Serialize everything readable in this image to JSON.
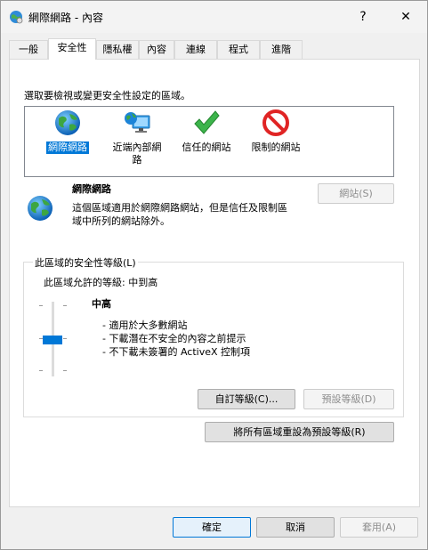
{
  "window": {
    "title": "網際網路 - 內容",
    "help_label": "?",
    "close_label": "✕"
  },
  "tabs": [
    "一般",
    "安全性",
    "隱私權",
    "內容",
    "連線",
    "程式",
    "進階"
  ],
  "security": {
    "zone_prompt": "選取要檢視或變更安全性設定的區域。",
    "zones": [
      {
        "label": "網際網路",
        "icon": "globe-icon"
      },
      {
        "label": "近端內部網\n路",
        "icon": "intranet-icon"
      },
      {
        "label": "信任的網站",
        "icon": "checkmark-icon"
      },
      {
        "label": "限制的網站",
        "icon": "restricted-icon"
      }
    ],
    "selected_zone": "網際網路",
    "zone_title": "網際網路",
    "zone_desc_line1": "這個區域適用於網際網路網站，但是信任及限制區",
    "zone_desc_line2": "域中所列的網站除外。",
    "sites_button": "網站(S)",
    "group_title": "此區域的安全性等級(L)",
    "allowed_levels": "此區域允許的等級: 中到高",
    "level_name": "中高",
    "level_bullets": [
      "- 適用於大多數網站",
      "- 下載潛在不安全的內容之前提示",
      "- 不下載未簽署的 ActiveX 控制項"
    ],
    "custom_level_button": "自訂等級(C)...",
    "default_level_button": "預設等級(D)",
    "reset_all_button": "將所有區域重設為預設等級(R)"
  },
  "footer": {
    "ok": "確定",
    "cancel": "取消",
    "apply": "套用(A)"
  },
  "colors": {
    "accent": "#0078d7",
    "window_bg": "#f0f0f0",
    "panel_bg": "#ffffff"
  }
}
